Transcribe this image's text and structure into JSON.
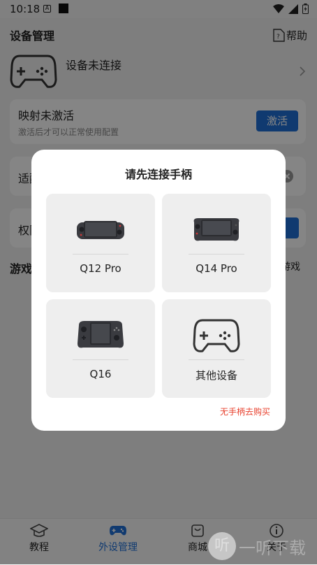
{
  "status_bar": {
    "time": "10:18"
  },
  "header": {
    "title": "设备管理",
    "help": "帮助"
  },
  "device": {
    "status": "设备未连接"
  },
  "mapping_card": {
    "title": "映射未激活",
    "subtitle": "激活后才可以正常使用配置",
    "button": "激活"
  },
  "adapt_card": {
    "title_partial": "适配"
  },
  "permission_card": {
    "title_partial": "权限"
  },
  "games_section": {
    "title": "游戏",
    "right": "游戏"
  },
  "tabs": [
    {
      "label": "教程",
      "icon": "graduation-cap-icon"
    },
    {
      "label": "外设管理",
      "icon": "gamepad-icon"
    },
    {
      "label": "商城",
      "icon": "store-bag-icon"
    },
    {
      "label": "关于",
      "icon": "info-icon"
    }
  ],
  "dialog": {
    "title": "请先连接手柄",
    "options": [
      {
        "name": "Q12 Pro",
        "icon": "q12pro-controller-image"
      },
      {
        "name": "Q14 Pro",
        "icon": "q14pro-controller-image"
      },
      {
        "name": "Q16",
        "icon": "q16-controller-image"
      },
      {
        "name": "其他设备",
        "icon": "gamepad-outline-icon"
      }
    ],
    "buy_link": "无手柄去购买"
  },
  "watermark": {
    "text": "一听下载",
    "glyph": "听"
  },
  "colors": {
    "accent": "#1f6fd6",
    "link_red": "#e8412e"
  }
}
